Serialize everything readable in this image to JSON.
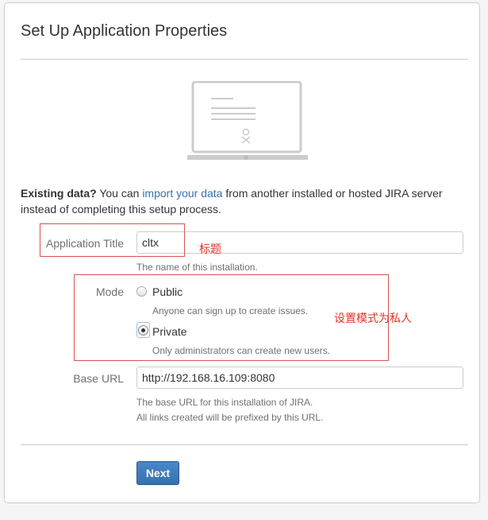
{
  "page": {
    "title": "Set Up Application Properties"
  },
  "existing_data": {
    "lead": "Existing data?",
    "text_before": " You can ",
    "link": "import your data",
    "text_after": " from another installed or hosted JIRA server instead of completing this setup process."
  },
  "form": {
    "app_title": {
      "label": "Application Title",
      "value": "cltx",
      "hint": "The name of this installation."
    },
    "mode": {
      "label": "Mode",
      "selected": "Private",
      "options": [
        {
          "label": "Public",
          "description": "Anyone can sign up to create issues.",
          "checked": false
        },
        {
          "label": "Private",
          "description": "Only administrators can create new users.",
          "checked": true
        }
      ]
    },
    "base_url": {
      "label": "Base URL",
      "value": "http://192.168.16.109:8080",
      "hint_line1": "The base URL for this installation of JIRA.",
      "hint_line2": "All links created will be prefixed by this URL."
    },
    "next_label": "Next"
  },
  "annotations": {
    "title_note": "标题",
    "mode_note": "设置模式为私人"
  },
  "colors": {
    "link": "#3572b0",
    "button": "#3572b0",
    "annotation": "#d9534f"
  }
}
